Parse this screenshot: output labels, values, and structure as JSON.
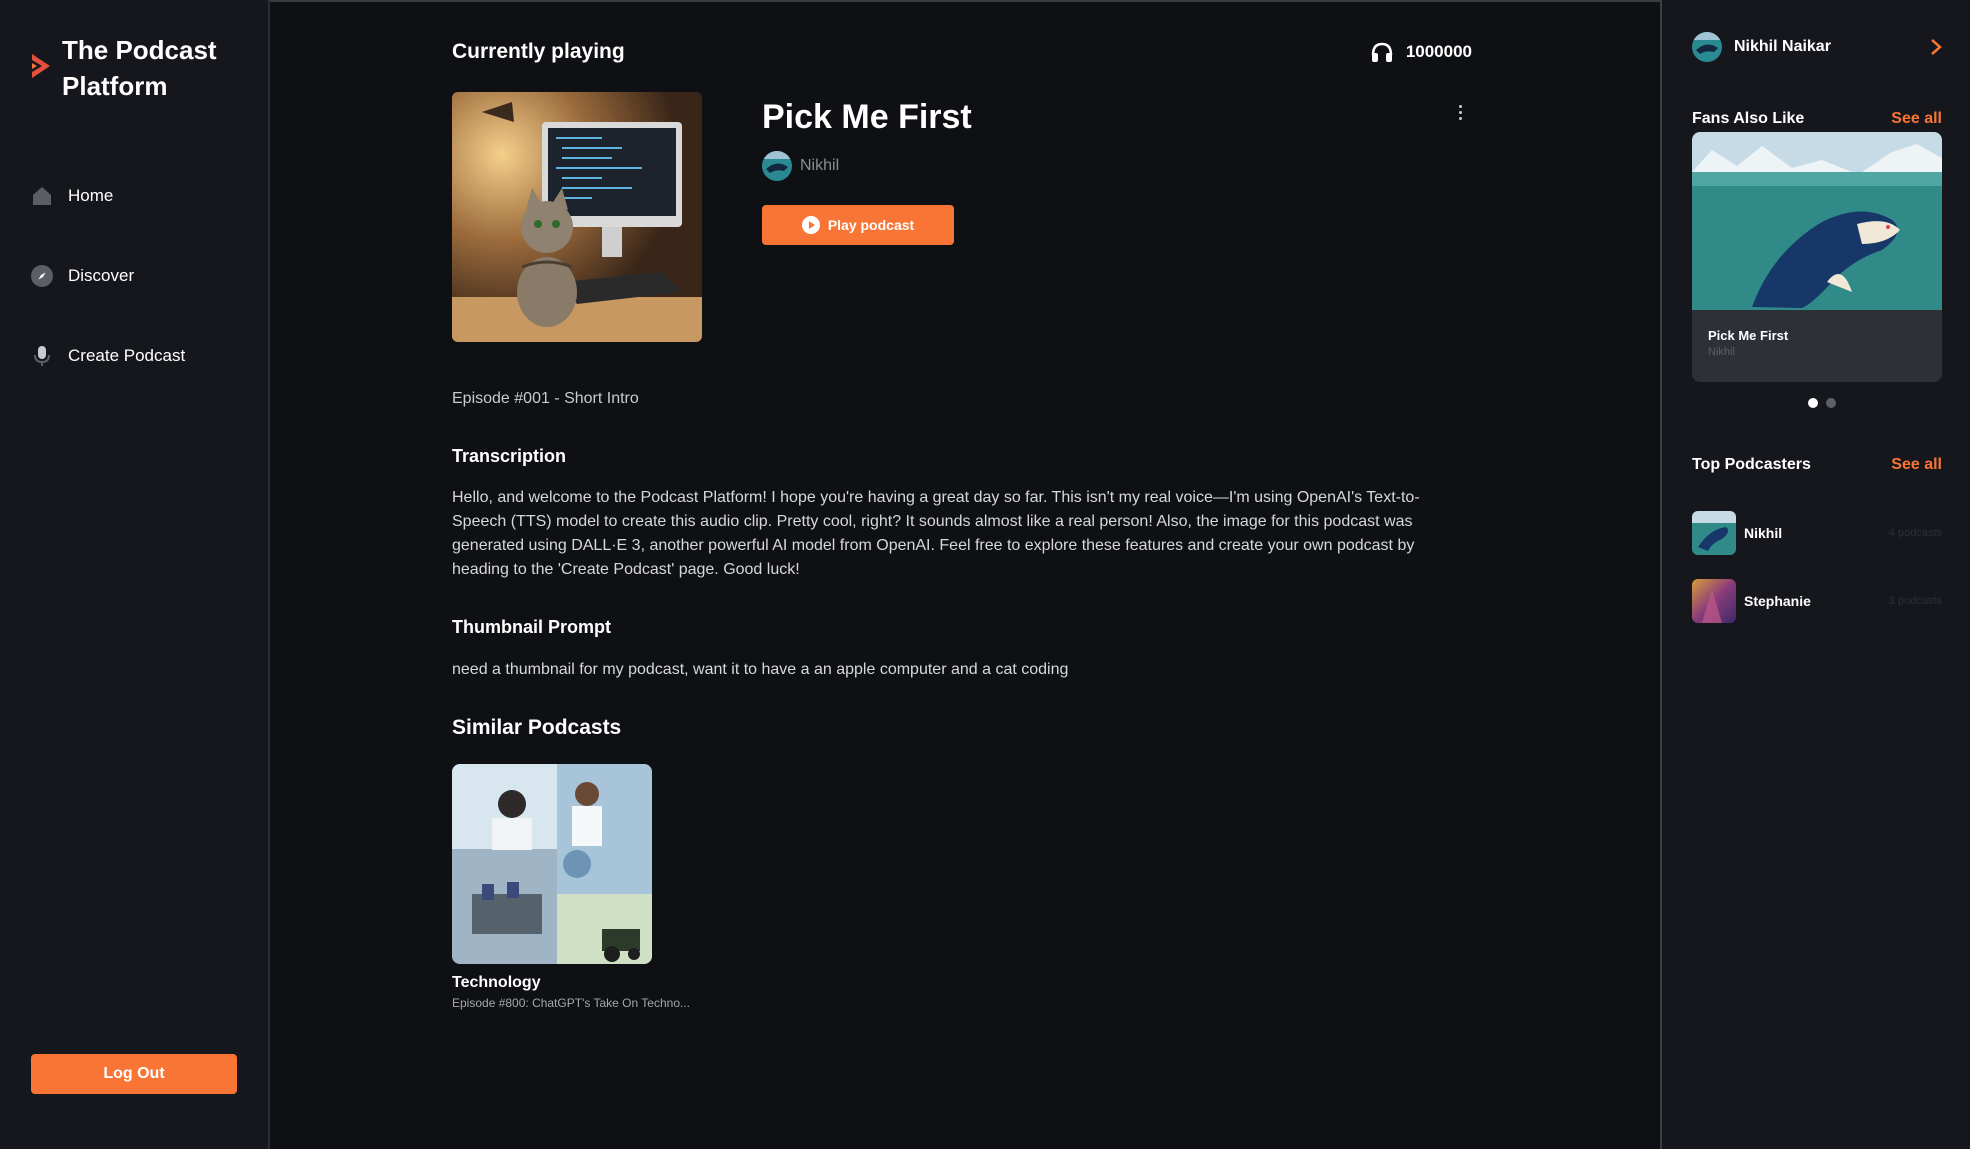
{
  "brand": {
    "title": "The Podcast Platform"
  },
  "nav": {
    "items": [
      {
        "label": "Home",
        "icon": "home-icon"
      },
      {
        "label": "Discover",
        "icon": "compass-icon"
      },
      {
        "label": "Create Podcast",
        "icon": "microphone-icon"
      }
    ]
  },
  "logout_label": "Log Out",
  "main": {
    "header": "Currently playing",
    "listeners": "1000000",
    "podcast": {
      "title": "Pick Me First",
      "author": "Nikhil",
      "play_label": "Play podcast"
    },
    "episode": "Episode #001 - Short Intro",
    "transcription_heading": "Transcription",
    "transcription": "Hello, and welcome to the Podcast Platform! I hope you're having a great day so far. This isn't my real voice—I'm using OpenAI's Text-to-Speech (TTS) model to create this audio clip. Pretty cool, right? It sounds almost like a real person! Also, the image for this podcast was generated using DALL·E 3, another powerful AI model from OpenAI. Feel free to explore these features and create your own podcast by heading to the 'Create Podcast' page. Good luck!",
    "thumbnail_heading": "Thumbnail Prompt",
    "thumbnail_prompt": "need a thumbnail for my podcast, want it to have a an apple computer and a cat coding",
    "similar_heading": "Similar Podcasts",
    "similar": [
      {
        "title": "Technology",
        "description": "Episode #800: ChatGPT's Take On Techno..."
      }
    ]
  },
  "right": {
    "user_name": "Nikhil Naikar",
    "fans_heading": "Fans Also Like",
    "fans_see_all": "See all",
    "fan_card": {
      "title": "Pick Me First",
      "author": "Nikhil"
    },
    "top_heading": "Top Podcasters",
    "top_see_all": "See all",
    "top_podcasters": [
      {
        "name": "Nikhil",
        "count": "4 podcasts"
      },
      {
        "name": "Stephanie",
        "count": "3 podcasts"
      }
    ]
  },
  "colors": {
    "accent": "#f97535",
    "background": "#0f1014",
    "sidebar": "#15171c"
  }
}
